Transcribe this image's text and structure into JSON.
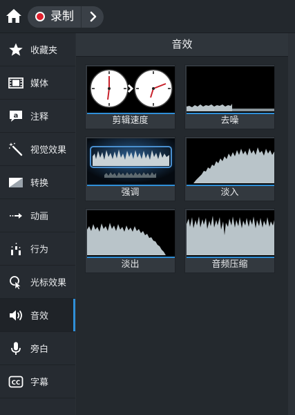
{
  "colors": {
    "accent": "#2f8fd8",
    "record": "#e0202e",
    "waveform": "#b9c4c9",
    "panel_bg": "#24292e",
    "sidebar_bg": "#262b31"
  },
  "topbar": {
    "home_icon": "home-icon",
    "breadcrumb_label": "录制",
    "record_icon": "record-dot-icon",
    "next_icon": "chevron-right-icon"
  },
  "sidebar": {
    "items": [
      {
        "label": "收藏夹",
        "icon": "star-icon"
      },
      {
        "label": "媒体",
        "icon": "film-icon"
      },
      {
        "label": "注释",
        "icon": "callout-icon"
      },
      {
        "label": "视觉效果",
        "icon": "magic-wand-icon"
      },
      {
        "label": "转换",
        "icon": "transition-icon"
      },
      {
        "label": "动画",
        "icon": "animation-arrow-icon"
      },
      {
        "label": "行为",
        "icon": "behavior-icon"
      },
      {
        "label": "光标效果",
        "icon": "cursor-effect-icon"
      },
      {
        "label": "音效",
        "icon": "speaker-icon",
        "active": true
      },
      {
        "label": "旁白",
        "icon": "microphone-icon"
      },
      {
        "label": "字幕",
        "icon": "cc-icon"
      }
    ]
  },
  "panel": {
    "title": "音效",
    "effects": [
      {
        "label": "剪辑速度",
        "thumb": "clip-speed"
      },
      {
        "label": "去噪",
        "thumb": "noise-removal"
      },
      {
        "label": "强调",
        "thumb": "emphasize"
      },
      {
        "label": "淡入",
        "thumb": "fade-in"
      },
      {
        "label": "淡出",
        "thumb": "fade-out"
      },
      {
        "label": "音频压缩",
        "thumb": "audio-compression"
      }
    ]
  }
}
